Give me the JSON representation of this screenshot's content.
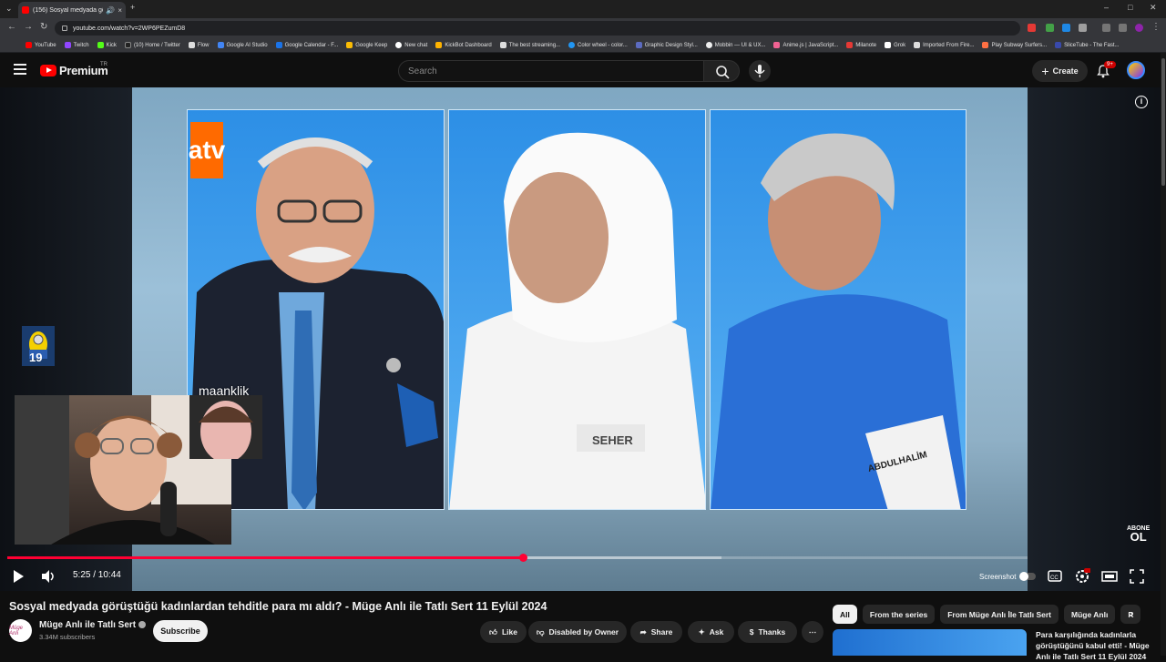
{
  "browser": {
    "tab_title": "(156) Sosyal medyada görüş",
    "url": "youtube.com/watch?v=2WP6PEZumD8",
    "bookmarks": [
      "YouTube",
      "Twitch",
      "Kick",
      "(10) Home / Twitter",
      "Flow",
      "Google AI Studio",
      "Google Calendar - F...",
      "Google Keep",
      "New chat",
      "KickBot Dashboard",
      "The best streaming...",
      "Color wheel - color...",
      "Graphic Design Styl...",
      "Mobbin — UI & UX...",
      "Anime.js | JavaScript...",
      "Milanote",
      "Grok",
      "Imported From Fire...",
      "Play Subway Surfers...",
      "SliceTube - The Fast..."
    ]
  },
  "header": {
    "logo_text": "Premium",
    "region": "TR",
    "search_placeholder": "Search",
    "create_label": "Create",
    "notif_badge": "9+"
  },
  "player": {
    "channel_overlay": "atv",
    "nameplate_2": "SEHER",
    "nameplate_3": "ABDULHALİM",
    "chat_name": "maanklik",
    "minion_badge": "19",
    "bone_top": "ABONE",
    "bone_bottom": "OL",
    "time_current": "5:25",
    "time_total": "10:44",
    "time_display": "5:25 / 10:44",
    "progress_fraction": 0.505,
    "buffer_fraction": 0.7,
    "screenshot_label": "Screenshot"
  },
  "video": {
    "title": "Sosyal medyada görüştüğü kadınlardan tehditle para mı aldı? - Müge Anlı ile Tatlı Sert 11 Eylül 2024",
    "channel_name": "Müge Anlı ile Tatlı Sert",
    "channel_avatar_text": "Müge Anlı",
    "subscribers": "3.34M subscribers",
    "subscribe_label": "Subscribe",
    "like_label": "Like",
    "dislike_label": "Disabled by Owner",
    "share_label": "Share",
    "ask_label": "Ask",
    "thanks_label": "Thanks"
  },
  "sidebar": {
    "chips": [
      "All",
      "From the series",
      "From Müge Anlı İle Tatlı Sert",
      "Müge Anlı",
      "R"
    ],
    "rec_title": "Para karşılığında kadınlarla görüştüğünü kabul etti! - Müge Anlı ile Tatlı Sert 11 Eylül 2024"
  },
  "colors": {
    "accent": "#ff0033",
    "atv_orange": "#ff6a00",
    "studio_blue": "#2d8fe6"
  }
}
